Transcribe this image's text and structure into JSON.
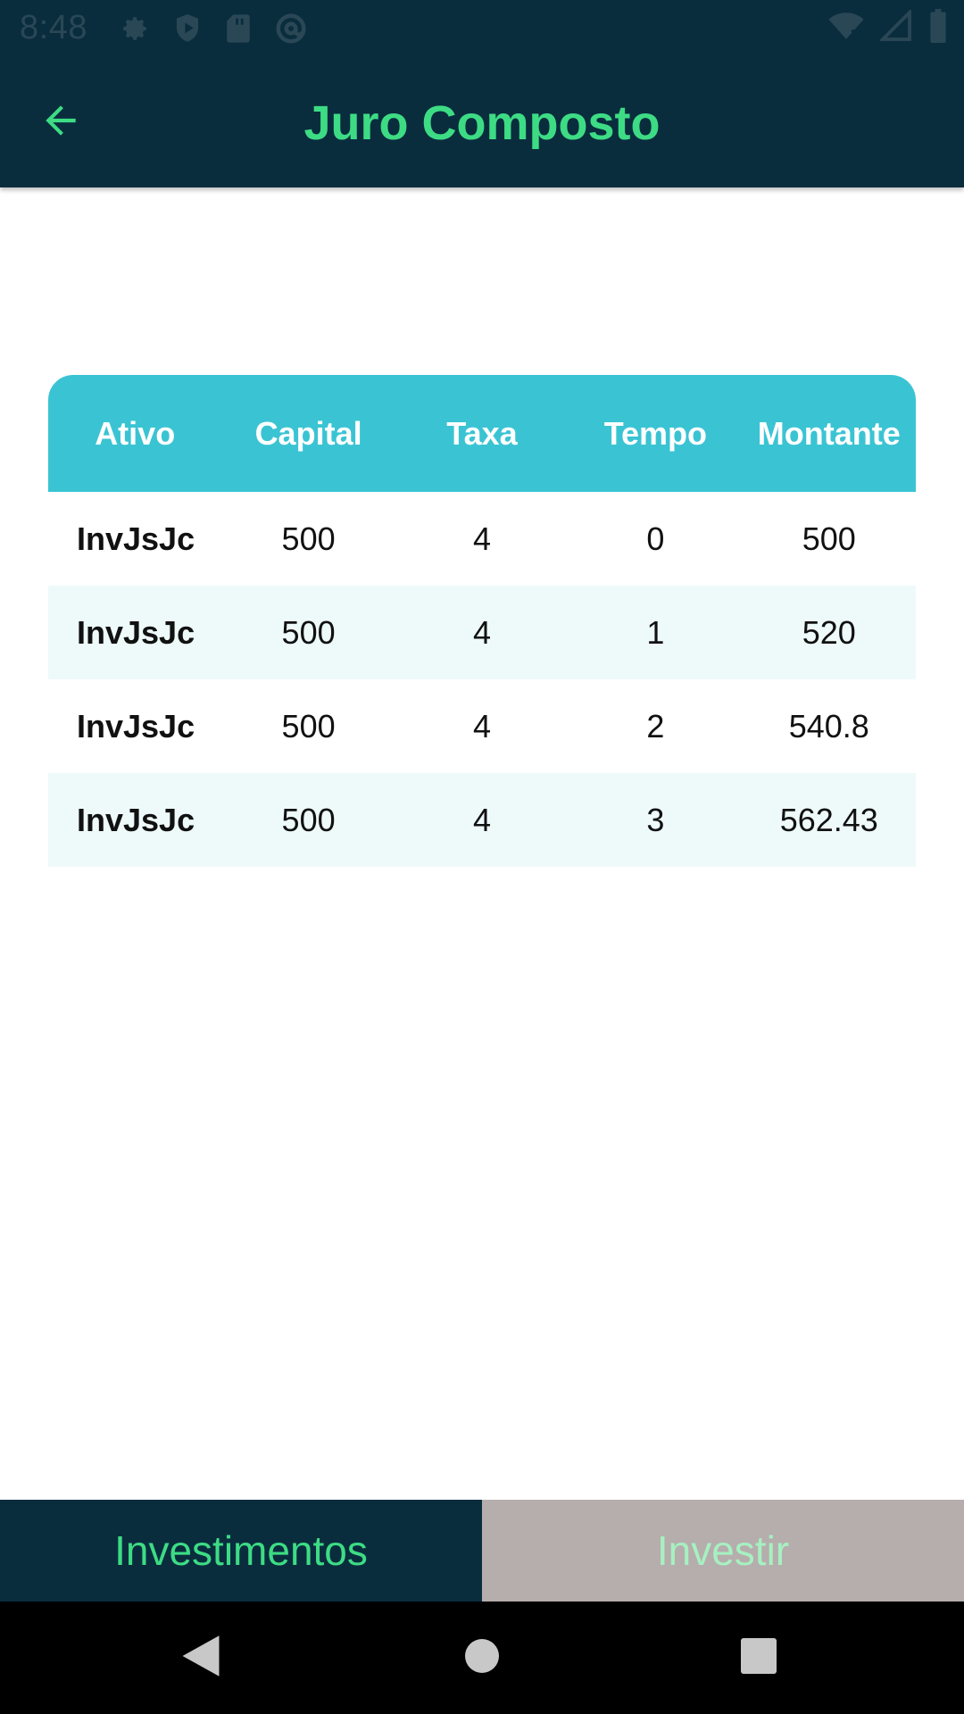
{
  "status_bar": {
    "time": "8:48",
    "icons": [
      "gear-icon",
      "shield-play-icon",
      "sd-card-icon",
      "at-sign-icon"
    ],
    "right_icons": [
      "wifi-off-icon",
      "signal-icon",
      "battery-icon"
    ]
  },
  "app_bar": {
    "title": "Juro Composto",
    "back_icon": "arrow-left-icon"
  },
  "table": {
    "headers": [
      "Ativo",
      "Capital",
      "Taxa",
      "Tempo",
      "Montante"
    ],
    "rows": [
      [
        "InvJsJc",
        "500",
        "4",
        "0",
        "500"
      ],
      [
        "InvJsJc",
        "500",
        "4",
        "1",
        "520"
      ],
      [
        "InvJsJc",
        "500",
        "4",
        "2",
        "540.8"
      ],
      [
        "InvJsJc",
        "500",
        "4",
        "3",
        "562.43"
      ]
    ]
  },
  "bottom_tabs": {
    "investments_label": "Investimentos",
    "invest_label": "Investir"
  },
  "colors": {
    "app_bar_bg": "#0a2d3e",
    "accent_green": "#3ddc84",
    "table_header_bg": "#3ac4d3",
    "row_alt_bg": "#eefafa",
    "inactive_tab_bg": "#b6adad"
  }
}
